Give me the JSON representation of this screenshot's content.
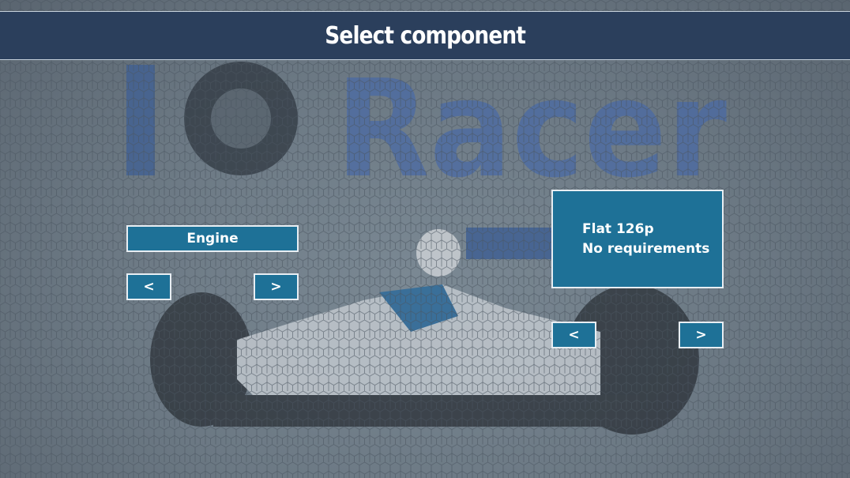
{
  "title": "Select component",
  "logo_text": "IO Racer",
  "component_selector": {
    "label": "Engine",
    "prev_label": "<",
    "next_label": ">"
  },
  "option_panel": {
    "name": "Flat 126p",
    "requirements": "No requirements",
    "prev_label": "<",
    "next_label": ">"
  },
  "colors": {
    "title_bar": "#2b3f5c",
    "button": "#1e7197",
    "border": "#e8eef3",
    "background": "#6d7b86"
  }
}
